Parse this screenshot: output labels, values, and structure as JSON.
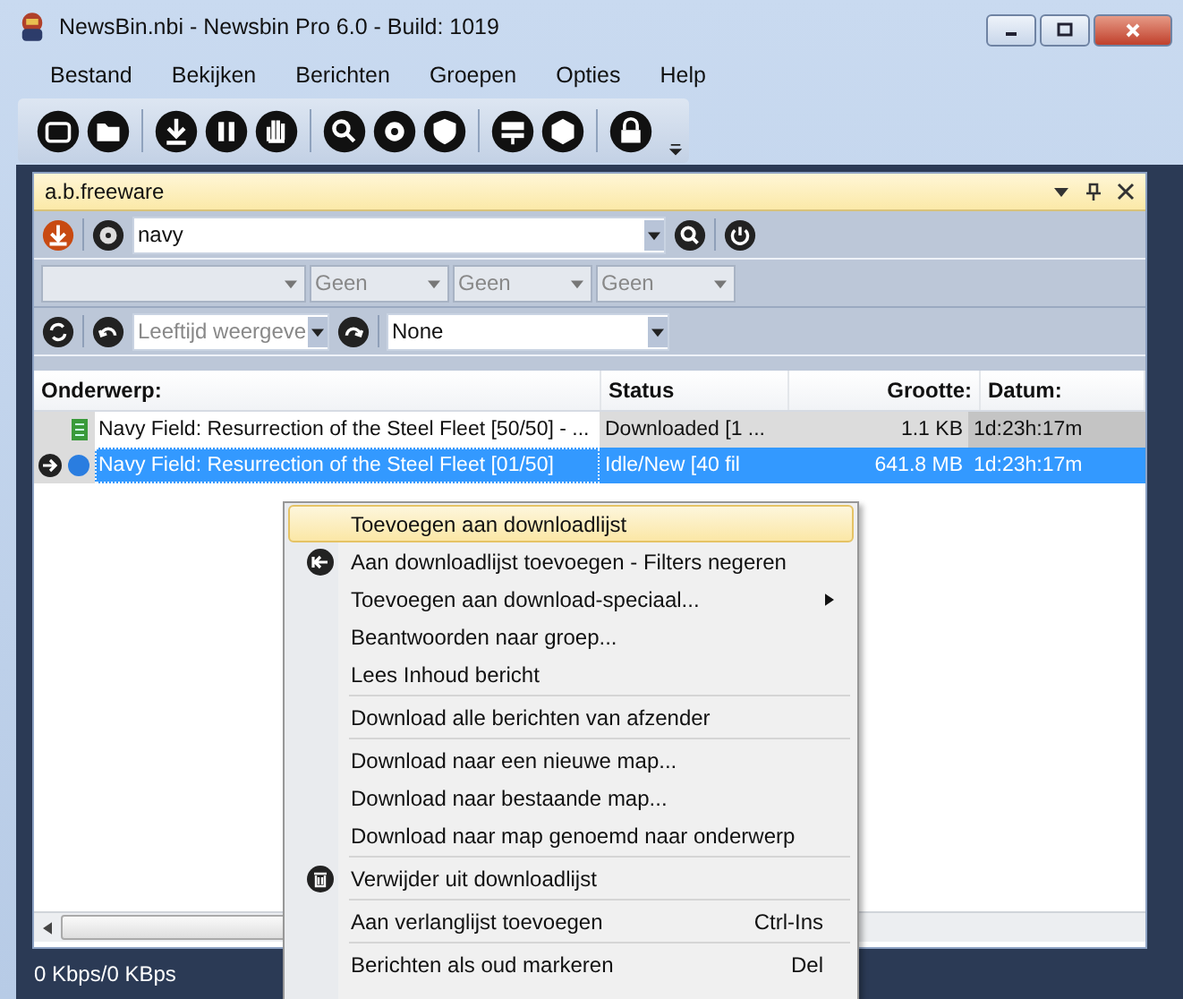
{
  "window": {
    "title": "NewsBin.nbi - Newsbin Pro 6.0 - Build: 1019"
  },
  "menu": [
    "Bestand",
    "Bekijken",
    "Berichten",
    "Groepen",
    "Opties",
    "Help"
  ],
  "panel": {
    "title": "a.b.freeware",
    "search": {
      "value": "navy"
    },
    "filters": [
      {
        "value": "Geen"
      },
      {
        "value": "Geen"
      },
      {
        "value": "Geen"
      }
    ],
    "age_filter": {
      "value": "Leeftijd weergeve",
      "disabled": true
    },
    "preset": {
      "value": "None"
    }
  },
  "table": {
    "columns": [
      "Onderwerp:",
      "Status",
      "Grootte:",
      "Datum:"
    ],
    "rows": [
      {
        "kind": "file",
        "subject": "Navy Field: Resurrection of the Steel Fleet [50/50] - ...",
        "status": "Downloaded [1 ...",
        "size": "1.1 KB",
        "date": "1d:23h:17m",
        "selected": false,
        "current": false
      },
      {
        "kind": "queued",
        "subject": "Navy Field: Resurrection of the Steel Fleet [01/50]",
        "status": "Idle/New [40 fil",
        "size": "641.8 MB",
        "date": "1d:23h:17m",
        "selected": true,
        "current": true
      }
    ]
  },
  "context_menu": {
    "groups": [
      [
        {
          "kind": "plain",
          "label": "Toevoegen aan downloadlijst",
          "selected": true
        },
        {
          "kind": "back",
          "label": "Aan downloadlijst toevoegen - Filters negeren",
          "selected": false
        },
        {
          "kind": "plain",
          "label": "Toevoegen aan download-speciaal...",
          "submenu": true,
          "selected": false
        },
        {
          "kind": "plain",
          "label": "Beantwoorden naar groep...",
          "selected": false
        },
        {
          "kind": "plain",
          "label": "Lees Inhoud bericht",
          "selected": false
        }
      ],
      [
        {
          "kind": "plain",
          "label": "Download alle berichten van afzender",
          "selected": false
        }
      ],
      [
        {
          "kind": "plain",
          "label": "Download naar een nieuwe map...",
          "selected": false
        },
        {
          "kind": "plain",
          "label": "Download naar bestaande map...",
          "selected": false
        },
        {
          "kind": "plain",
          "label": "Download naar map genoemd naar onderwerp",
          "selected": false
        }
      ],
      [
        {
          "kind": "trash",
          "label": "Verwijder uit downloadlijst",
          "selected": false
        }
      ],
      [
        {
          "kind": "plain",
          "label": "Aan verlanglijst toevoegen",
          "shortcut": "Ctrl-Ins",
          "selected": false
        }
      ],
      [
        {
          "kind": "plain",
          "label": "Berichten als oud markeren",
          "shortcut": "Del",
          "selected": false
        }
      ]
    ]
  },
  "status_bar": "0 Kbps/0 KBps"
}
